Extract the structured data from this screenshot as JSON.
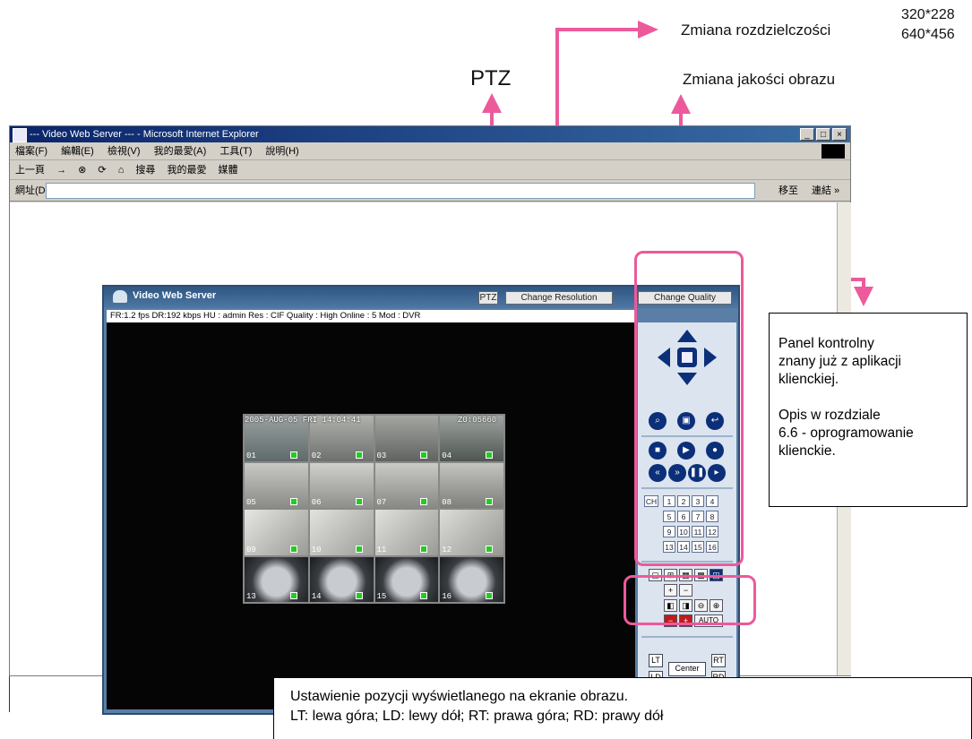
{
  "annotations": {
    "resolution_values": [
      "320*228",
      "640*456"
    ],
    "resolution_change": "Zmiana rozdzielczości",
    "ptz": "PTZ",
    "quality_change": "Zmiana jakości obrazu",
    "panel_note_line1": "Panel kontrolny",
    "panel_note_line2": "znany już z aplikacji",
    "panel_note_line3": "klienckiej.",
    "panel_note_line4": "Opis w  rozdziale",
    "panel_note_line5": "6.6 - oprogramowanie",
    "panel_note_line6": "klienckie.",
    "position_note_line1": "Ustawienie pozycji wyświetlanego na ekranie obrazu.",
    "position_note_line2": "LT: lewa góra; LD: lewy dół; RT: prawa góra; RD: prawy dół",
    "highlight_color": "#ec5a9b"
  },
  "browser": {
    "title": "--- Video Web Server --- - Microsoft Internet Explorer",
    "menu": [
      "檔案(F)",
      "編輯(E)",
      "檢視(V)",
      "我的最愛(A)",
      "工具(T)",
      "說明(H)"
    ],
    "toolbar": [
      "上一頁",
      "→",
      "⊗",
      "⟳",
      "⌂",
      "搜尋",
      "我的最愛",
      "媒體"
    ],
    "address_label": "網址(D)",
    "go_label": "移至",
    "links_label": "連結 »"
  },
  "app": {
    "title": "Video Web Server",
    "ptz_button": "PTZ",
    "change_resolution_button": "Change Resolution",
    "change_quality_button": "Change Quality",
    "status": "FR:1.2 fps  DR:192 kbps  HU : admin  Res : CIF  Quality : High  Online : 5 Mod : DVR",
    "timestamp": "2005-AUG-05 FRI 14:04:41",
    "timestamp_right": "Z0:05660",
    "cameras": [
      "01",
      "02",
      "03",
      "04",
      "05",
      "06",
      "07",
      "08",
      "09",
      "10",
      "11",
      "12",
      "13",
      "14",
      "15",
      "16"
    ],
    "ch_label": "CH",
    "channels": [
      "1",
      "2",
      "3",
      "4",
      "5",
      "6",
      "7",
      "8",
      "9",
      "10",
      "11",
      "12",
      "13",
      "14",
      "15",
      "16"
    ],
    "auto_label": "AUTO",
    "pos": {
      "lt": "LT",
      "ld": "LD",
      "center": "Center",
      "rt": "RT",
      "rd": "RD"
    }
  }
}
